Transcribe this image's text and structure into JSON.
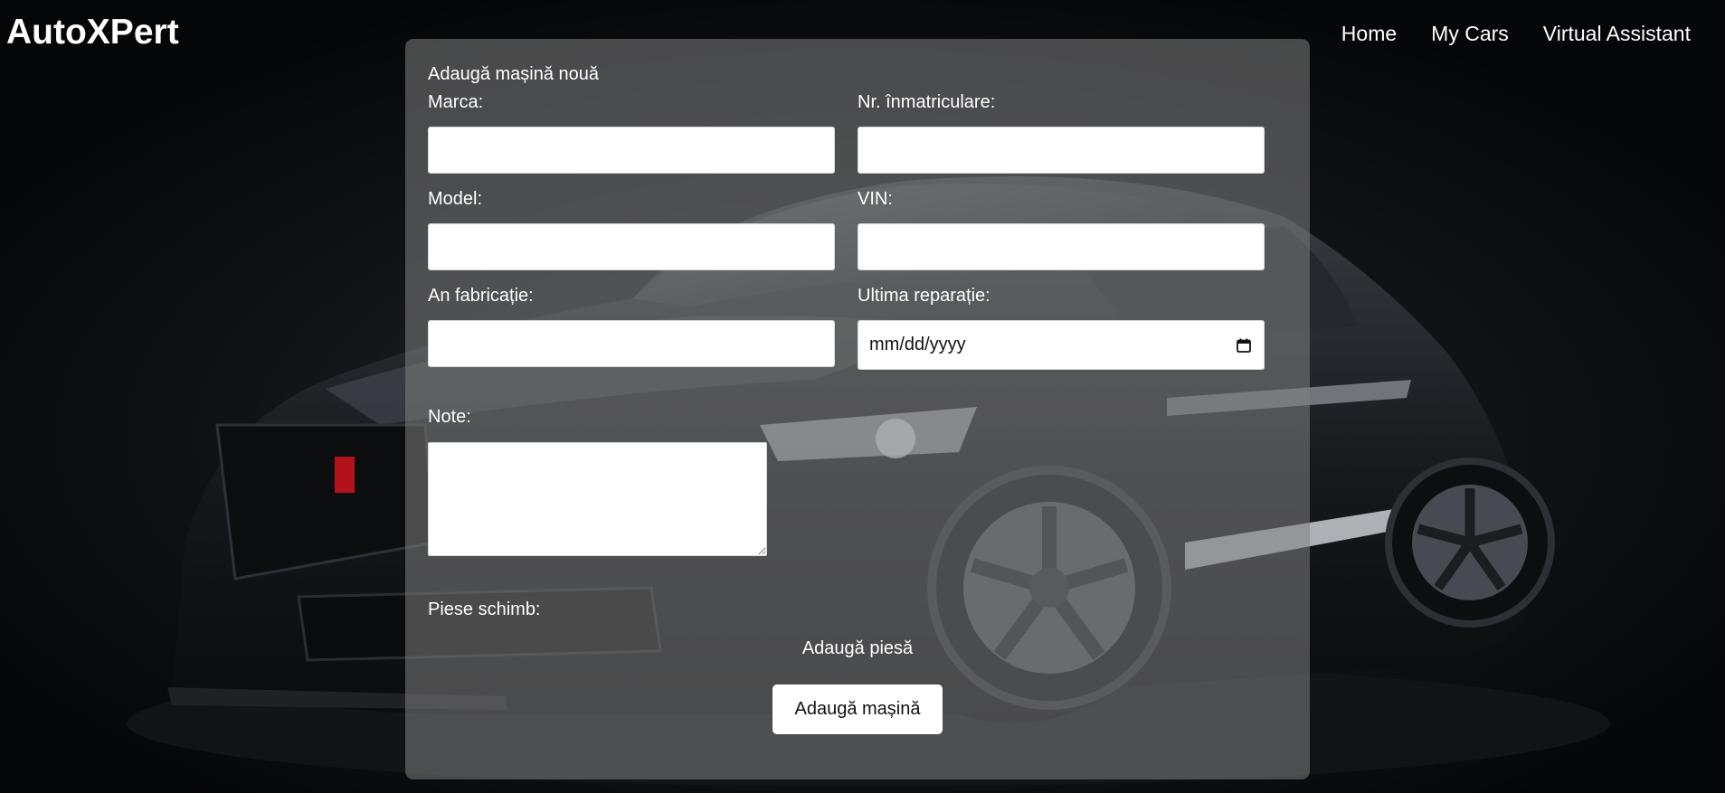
{
  "header": {
    "brand": "AutoXPert",
    "nav": [
      "Home",
      "My Cars",
      "Virtual Assistant"
    ]
  },
  "form": {
    "title": "Adaugă mașină nouă",
    "fields": {
      "marca": {
        "label": "Marca:",
        "value": ""
      },
      "nr_inmatriculare": {
        "label": "Nr. înmatriculare:",
        "value": ""
      },
      "model": {
        "label": "Model:",
        "value": ""
      },
      "vin": {
        "label": "VIN:",
        "value": ""
      },
      "an_fabricatie": {
        "label": "An fabricație:",
        "value": ""
      },
      "ultima_reparatie": {
        "label": "Ultima reparație:",
        "placeholder": "mm/dd/yyyy"
      },
      "note": {
        "label": "Note:",
        "value": ""
      }
    },
    "parts_label": "Piese schimb:",
    "add_part_label": "Adaugă piesă",
    "submit_label": "Adaugă mașină"
  },
  "icons": {
    "date_picker": "calendar-icon",
    "textarea_resize": "resize-grip-icon"
  },
  "colors": {
    "page_background": "#07080b",
    "panel_background": "rgba(128,128,128,0.55)",
    "text": "#ffffff",
    "input_background": "#ffffff"
  }
}
